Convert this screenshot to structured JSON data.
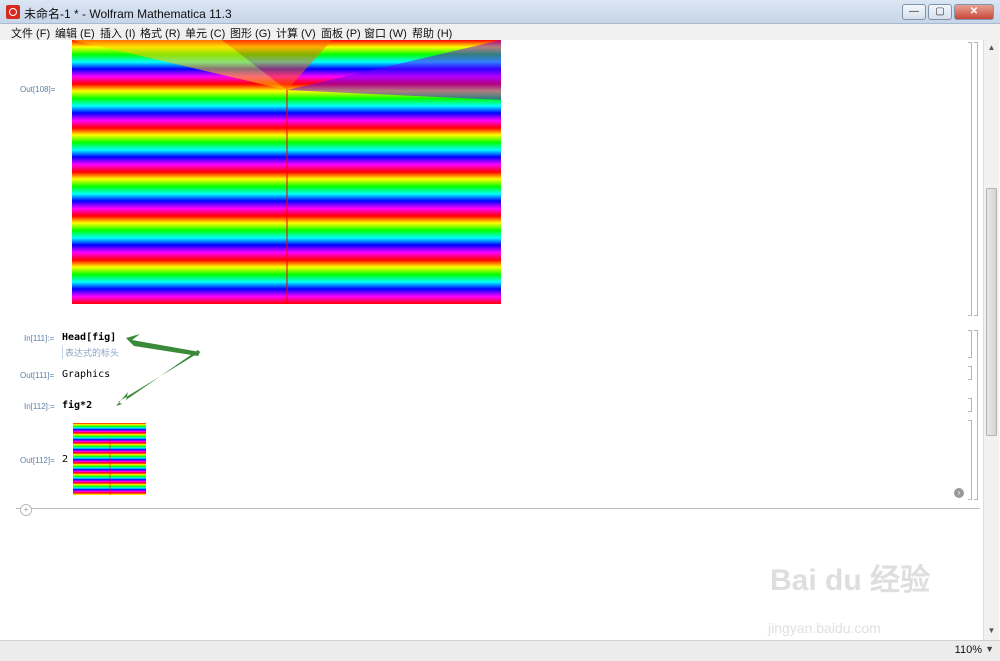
{
  "window": {
    "title": "未命名-1 * - Wolfram Mathematica 11.3",
    "buttons": [
      "—",
      "▢",
      "✕"
    ]
  },
  "menu": [
    "文件 (F)",
    "编辑 (E)",
    "插入 (I)",
    "格式 (R)",
    "单元 (C)",
    "图形 (G)",
    "计算 (V)",
    "面板 (P)",
    "窗口 (W)",
    "帮助 (H)"
  ],
  "cells": {
    "out108_label": "Out[108]=",
    "in111_label": "In[111]:=",
    "in111_code": "Head[fig]",
    "in111_hint": "表达式的标头",
    "out111_label": "Out[111]=",
    "out111_value": "Graphics",
    "in112_label": "In[112]:=",
    "in112_code": "fig*2",
    "out112_label": "Out[112]=",
    "out112_coef": "2"
  },
  "status": {
    "zoom": "110%",
    "zoom_arrow": "▼"
  },
  "watermark": {
    "brand": "Bai du 经验",
    "url": "jingyan.baidu.com"
  },
  "colors": {
    "arrow": "#3a8a3a",
    "cell_label": "#5d7fa8"
  }
}
